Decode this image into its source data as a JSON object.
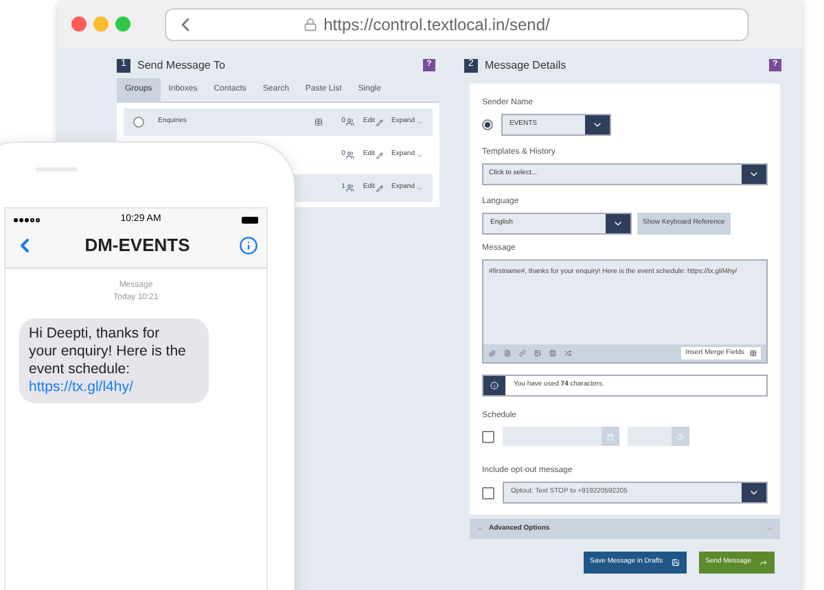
{
  "browser": {
    "url": "https://control.textlocal.in/send/"
  },
  "send_to": {
    "step": "1",
    "title": "Send Message To",
    "help": "?",
    "tabs": [
      {
        "label": "Groups",
        "selected": true
      },
      {
        "label": "Inboxes",
        "selected": false
      },
      {
        "label": "Contacts",
        "selected": false
      },
      {
        "label": "Search",
        "selected": false
      },
      {
        "label": "Paste List",
        "selected": false
      },
      {
        "label": "Single",
        "selected": false
      }
    ],
    "groups": [
      {
        "name": "Enquiries",
        "selected": false,
        "count": "0",
        "edit": "Edit",
        "expand": "Expand"
      },
      {
        "count": "0",
        "edit": "Edit",
        "expand": "Expand"
      },
      {
        "count": "1",
        "edit": "Edit",
        "expand": "Expand"
      }
    ]
  },
  "message_details": {
    "step": "2",
    "title": "Message Details",
    "help": "?",
    "sender": {
      "label": "Sender Name",
      "value": "EVENTS",
      "selected": true
    },
    "templates": {
      "label": "Templates & History",
      "value": "Click to select..."
    },
    "language": {
      "label": "Language",
      "value": "English",
      "button": "Show Keyboard Reference"
    },
    "message": {
      "label": "Message",
      "value": "#firstname#, thanks for your enquiry! Here is the event schedule: https://tx.gl/l4hy/",
      "merge_button": "Insert Merge Fields"
    },
    "char_count": "You have used **74** characters.",
    "schedule": {
      "label": "Schedule",
      "checked": false
    },
    "optout": {
      "label": "Include opt-out message",
      "checked": false,
      "value": "Optout: Text STOP to +919220592205"
    },
    "advanced": "Advanced Options",
    "buttons": [
      {
        "kind": "save",
        "label": "Save Message in Drafts"
      },
      {
        "kind": "send",
        "label": "Send Message"
      }
    ]
  },
  "phone": {
    "time": "10:29 AM",
    "contact": "DM-EVENTS",
    "meta_title": "Message",
    "meta_time": "Today 10:21",
    "bubble": "Hi Deepti, thanks for your enquiry! Here is the event schedule:",
    "link": "https://tx.gl/l4hy/"
  }
}
